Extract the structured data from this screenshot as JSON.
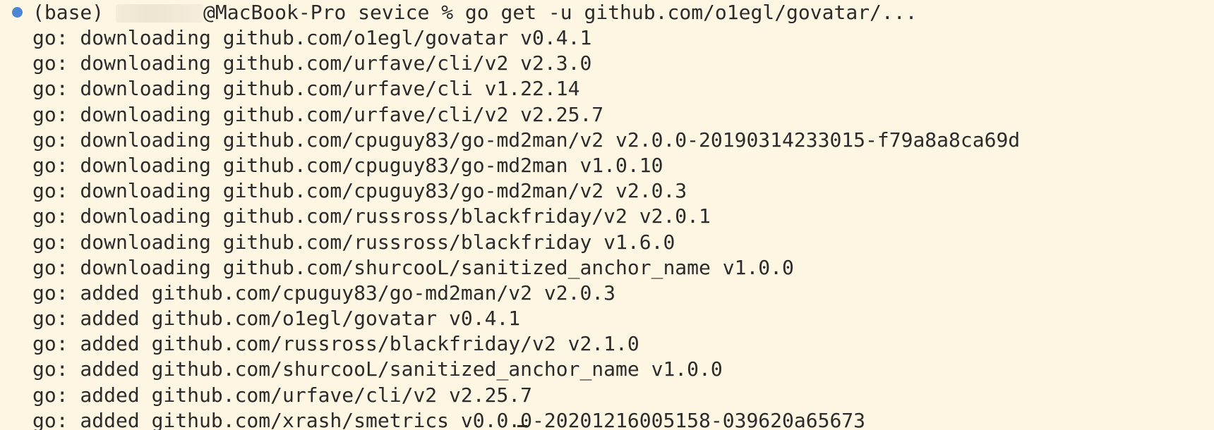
{
  "terminal": {
    "prompt": {
      "env": "(base)",
      "host_suffix": "@MacBook-Pro",
      "directory": "sevice",
      "symbol": "%",
      "command": "go get -u github.com/o1egl/govatar/..."
    },
    "output_lines": [
      "go: downloading github.com/o1egl/govatar v0.4.1",
      "go: downloading github.com/urfave/cli/v2 v2.3.0",
      "go: downloading github.com/urfave/cli v1.22.14",
      "go: downloading github.com/urfave/cli/v2 v2.25.7",
      "go: downloading github.com/cpuguy83/go-md2man/v2 v2.0.0-20190314233015-f79a8a8ca69d",
      "go: downloading github.com/cpuguy83/go-md2man v1.0.10",
      "go: downloading github.com/cpuguy83/go-md2man/v2 v2.0.3",
      "go: downloading github.com/russross/blackfriday/v2 v2.0.1",
      "go: downloading github.com/russross/blackfriday v1.6.0",
      "go: downloading github.com/shurcooL/sanitized_anchor_name v1.0.0",
      "go: added github.com/cpuguy83/go-md2man/v2 v2.0.3",
      "go: added github.com/o1egl/govatar v0.4.1",
      "go: added github.com/russross/blackfriday/v2 v2.1.0",
      "go: added github.com/shurcooL/sanitized_anchor_name v1.0.0",
      "go: added github.com/urfave/cli/v2 v2.25.7",
      "go: added github.com/xrash/smetrics v0.0.0-20201216005158-039620a65673"
    ],
    "colors": {
      "background": "#fdf6e3",
      "text": "#2b2b2b",
      "status_dot": "#4a86d4"
    }
  }
}
